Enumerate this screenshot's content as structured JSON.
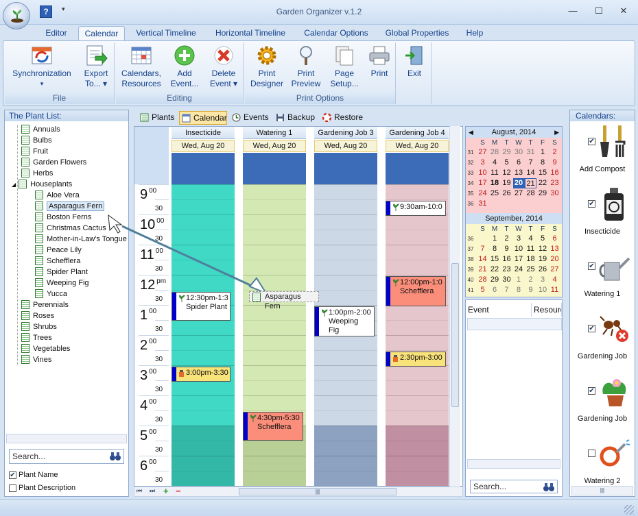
{
  "app": {
    "title": "Garden Organizer v.1.2",
    "help_glyph": "?",
    "qat_more": "▾"
  },
  "window": {
    "min": "—",
    "max": "☐",
    "close": "✕"
  },
  "tabs": [
    {
      "label": "Editor"
    },
    {
      "label": "Calendar"
    },
    {
      "label": "Vertical Timeline"
    },
    {
      "label": "Horizontal Timeline"
    },
    {
      "label": "Calendar Options"
    },
    {
      "label": "Global Properties"
    },
    {
      "label": "Help"
    }
  ],
  "ribbon": {
    "file": {
      "label": "File",
      "sync": "Synchronization",
      "sync_arrow": "▾",
      "export": "Export",
      "export2": "To... ▾"
    },
    "editing": {
      "label": "Editing",
      "calendars": "Calendars,",
      "calendars2": "Resources",
      "add": "Add",
      "add2": "Event...",
      "delete": "Delete",
      "delete2": "Event ▾"
    },
    "print": {
      "label": "Print Options",
      "designer": "Print",
      "designer2": "Designer",
      "preview": "Print",
      "preview2": "Preview",
      "setup": "Page",
      "setup2": "Setup...",
      "print": "Print"
    },
    "exit": {
      "label": "Exit"
    }
  },
  "plant_list": {
    "header": "The Plant List:",
    "expander": "◢",
    "items": [
      {
        "label": "Annuals"
      },
      {
        "label": "Bulbs"
      },
      {
        "label": "Fruit"
      },
      {
        "label": "Garden Flowers"
      },
      {
        "label": "Herbs"
      },
      {
        "label": "Houseplants"
      },
      {
        "label": "Aloe Vera"
      },
      {
        "label": "Asparagus Fern"
      },
      {
        "label": "Boston Ferns"
      },
      {
        "label": "Christmas Cactus"
      },
      {
        "label": "Mother-in-Law's Tongue"
      },
      {
        "label": "Peace Lily"
      },
      {
        "label": "Schefflera"
      },
      {
        "label": "Spider Plant"
      },
      {
        "label": "Weeping Fig"
      },
      {
        "label": "Yucca"
      },
      {
        "label": "Perennials"
      },
      {
        "label": "Roses"
      },
      {
        "label": "Shrubs"
      },
      {
        "label": "Trees"
      },
      {
        "label": "Vegetables"
      },
      {
        "label": "Vines"
      }
    ],
    "search_placeholder": "Search...",
    "opt_name": "Plant Name",
    "opt_desc": "Plant Description",
    "opt_name_checked": "✔"
  },
  "view_tabs": [
    {
      "label": "Plants"
    },
    {
      "label": "Calendar"
    },
    {
      "label": "Events"
    },
    {
      "label": "Backup"
    },
    {
      "label": "Restore"
    }
  ],
  "calendar": {
    "hours": [
      {
        "h": "9",
        "m": "00"
      },
      {
        "h": "10",
        "m": "00"
      },
      {
        "h": "11",
        "m": "00"
      },
      {
        "h": "12",
        "m": "pm"
      },
      {
        "h": "1",
        "m": "00"
      },
      {
        "h": "2",
        "m": "00"
      },
      {
        "h": "3",
        "m": "00"
      },
      {
        "h": "4",
        "m": "00"
      },
      {
        "h": "5",
        "m": "00"
      },
      {
        "h": "6",
        "m": "00"
      }
    ],
    "half": "30",
    "columns": [
      {
        "name": "Insecticide",
        "date": "Wed, Aug 20",
        "color": "#3fd9c6",
        "dark": "#33b8a8"
      },
      {
        "name": "Watering 1",
        "date": "Wed, Aug 20",
        "color": "#d3e8b3",
        "dark": "#b8cf96"
      },
      {
        "name": "Gardening Job 3",
        "date": "Wed, Aug 20",
        "color": "#ccd8e6",
        "dark": "#8da1c0"
      },
      {
        "name": "Gardening Job 4",
        "date": "Wed, Aug 20",
        "color": "#e5c6cc",
        "dark": "#c08fa1"
      }
    ],
    "events": [
      {
        "time": "12:30pm-1:3",
        "title": "Spider Plant"
      },
      {
        "time": "3:00pm-3:30",
        "title": ""
      },
      {
        "time": "4:30pm-5:30",
        "title": "Schefflera"
      },
      {
        "time": "1:00pm-2:00",
        "title": "Weeping",
        "title2": "Fig"
      },
      {
        "time": "9:30am-10:0",
        "title": ""
      },
      {
        "time": "12:00pm-1:0",
        "title": "Schefflera"
      },
      {
        "time": "2:30pm-3:00",
        "title": ""
      }
    ],
    "drag_ghost": "Asparagus Fern"
  },
  "minical": {
    "aug": {
      "title": "August, 2014",
      "prev": "◀",
      "next": "▶"
    },
    "sep": {
      "title": "September, 2014"
    },
    "dow": [
      "S",
      "M",
      "T",
      "W",
      "T",
      "F",
      "S"
    ]
  },
  "event_list": {
    "col_event": "Event",
    "col_resource": "Resource",
    "search_placeholder": "Search..."
  },
  "calendars_panel": {
    "header": "Calendars:",
    "items": [
      {
        "label": "Add Compost",
        "checked": "✔"
      },
      {
        "label": "Insecticide",
        "checked": "✔"
      },
      {
        "label": "Watering 1",
        "checked": "✔"
      },
      {
        "label": "Gardening Job",
        "checked": "✔"
      },
      {
        "label": "Gardening Job",
        "checked": "✔"
      },
      {
        "label": "Watering 2",
        "checked": ""
      }
    ]
  },
  "nav": {
    "first": "⏮",
    "last": "⏭",
    "add": "+",
    "remove": "−",
    "scroll": "|||"
  }
}
